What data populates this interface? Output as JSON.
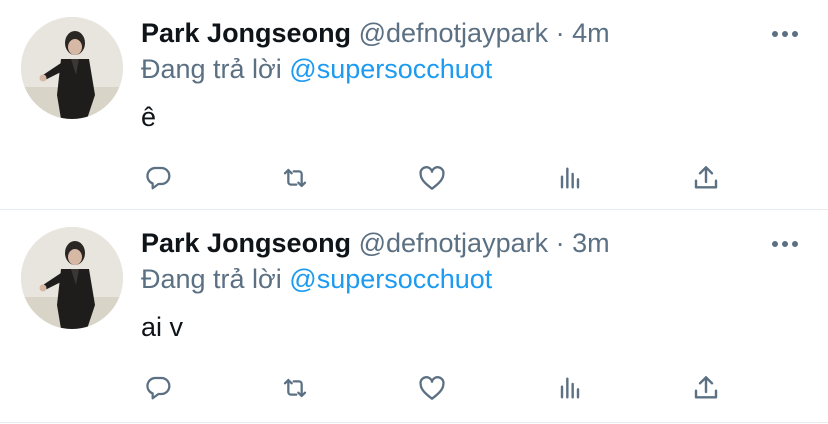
{
  "tweets": [
    {
      "display_name": "Park Jongseong",
      "handle": "@defnotjaypark",
      "separator": "·",
      "time": "4m",
      "replying_prefix": "Đang trả lời",
      "replying_to": "@supersocchuot",
      "text": "ê"
    },
    {
      "display_name": "Park Jongseong",
      "handle": "@defnotjaypark",
      "separator": "·",
      "time": "3m",
      "replying_prefix": "Đang trả lời",
      "replying_to": "@supersocchuot",
      "text": "ai v"
    }
  ],
  "icons": {
    "more": "more-horizontal-icon",
    "reply": "reply-bubble-icon",
    "retweet": "retweet-icon",
    "like": "heart-icon",
    "stats": "analytics-bars-icon",
    "share": "share-upload-icon"
  },
  "colors": {
    "primary_text": "#0f1419",
    "secondary_text": "#5b7083",
    "mention": "#1d9bf0",
    "divider": "#e6ecf0"
  }
}
